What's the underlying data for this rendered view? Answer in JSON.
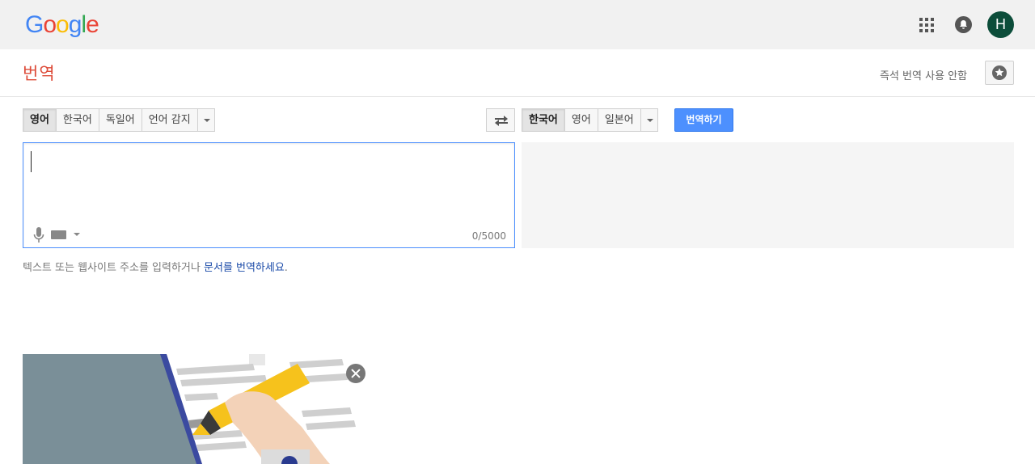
{
  "header": {
    "logo_letters": [
      {
        "char": "G",
        "color": "#4285f4"
      },
      {
        "char": "o",
        "color": "#ea4335"
      },
      {
        "char": "o",
        "color": "#fbbc05"
      },
      {
        "char": "g",
        "color": "#4285f4"
      },
      {
        "char": "l",
        "color": "#34a853"
      },
      {
        "char": "e",
        "color": "#ea4335"
      }
    ],
    "avatar_initial": "H",
    "avatar_color": "#0c4d3a",
    "icons": [
      "apps-grid-icon",
      "notifications-bell-icon"
    ]
  },
  "page": {
    "title": "번역",
    "instant_translation_toggle": "즉석 번역 사용 안함"
  },
  "source_languages": {
    "options": [
      "영어",
      "한국어",
      "독일어",
      "언어 감지"
    ],
    "selected": "영어"
  },
  "target_languages": {
    "options": [
      "한국어",
      "영어",
      "일본어"
    ],
    "selected": "한국어"
  },
  "translate_button": "번역하기",
  "source_input": {
    "value": "",
    "char_count": "0/5000"
  },
  "hint": {
    "text": "텍스트 또는 웹사이트 주소를 입력하거나 ",
    "link": "문서를 번역하세요",
    "suffix": "."
  },
  "colors": {
    "brand_red": "#dd4b39",
    "translate_blue": "#4d90fe",
    "link_blue": "#1a4aa8"
  }
}
